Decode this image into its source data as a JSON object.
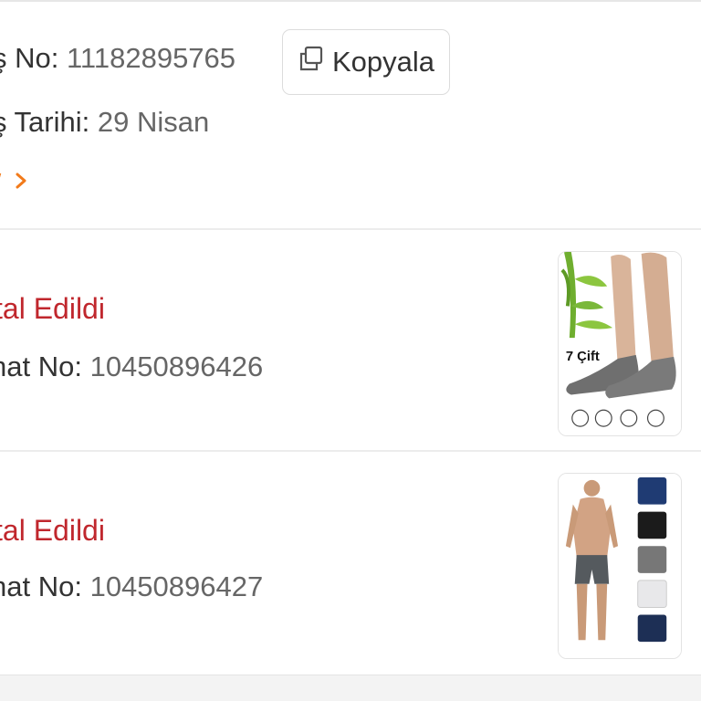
{
  "order": {
    "number_label": "ş No:",
    "number_value": "11182895765",
    "copy_label": "Kopyala",
    "date_label": "ş Tarihi:",
    "date_value": "29 Nisan"
  },
  "items": [
    {
      "status": "tal Edildi",
      "return_label": "hat No:",
      "return_value": "10450896426",
      "image_caption": "7 Çift",
      "image_icon": "socks-product-image"
    },
    {
      "status": "tal Edildi",
      "return_label": "hat No:",
      "return_value": "10450896427",
      "image_icon": "boxer-product-image"
    }
  ],
  "colors": {
    "status_red": "#c0272d",
    "accent_orange": "#f27a1a",
    "label_text": "#333333",
    "value_text": "#666666"
  }
}
